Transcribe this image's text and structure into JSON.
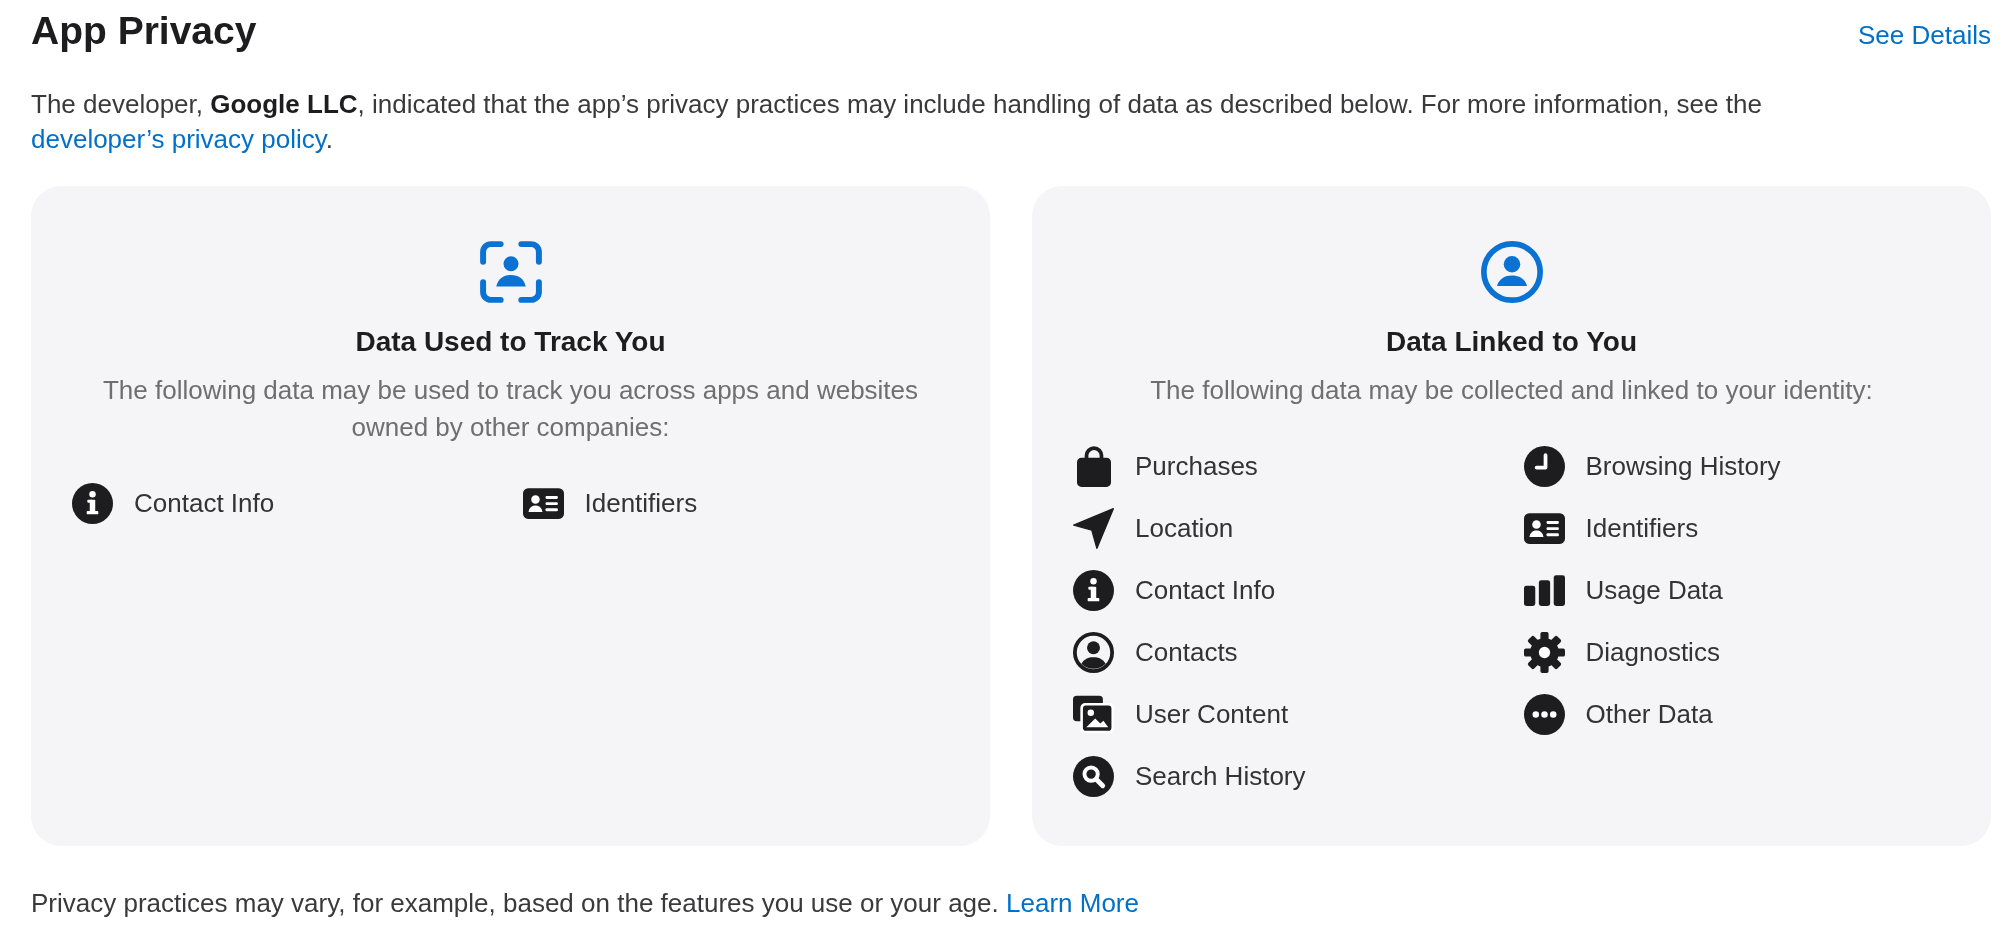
{
  "header": {
    "title": "App Privacy",
    "link": "See Details"
  },
  "intro": {
    "text": "The developer, **Google LLC**, indicated that the app’s privacy practices may include handling of data as described below. For more information, see the",
    "link": "developer’s privacy policy",
    "after": "."
  },
  "cards": [
    {
      "kind": "tracking",
      "title": "Data Used to Track You",
      "description": "The following data may be used to track you across apps and websites owned by other companies:",
      "items": [
        {
          "kind": "info",
          "label": "Contact Info"
        },
        {
          "kind": "idcard",
          "label": "Identifiers"
        }
      ]
    },
    {
      "kind": "linked",
      "title": "Data Linked to You",
      "description": "The following data may be collected and linked to your identity:",
      "items": [
        {
          "kind": "bag",
          "label": "Purchases"
        },
        {
          "kind": "location",
          "label": "Location"
        },
        {
          "kind": "info",
          "label": "Contact Info"
        },
        {
          "kind": "person",
          "label": "Contacts"
        },
        {
          "kind": "photos",
          "label": "User Content"
        },
        {
          "kind": "search",
          "label": "Search History"
        },
        {
          "kind": "clock",
          "label": "Browsing History"
        },
        {
          "kind": "idcard",
          "label": "Identifiers"
        },
        {
          "kind": "bars",
          "label": "Usage Data"
        },
        {
          "kind": "gear",
          "label": "Diagnostics"
        },
        {
          "kind": "ellipsis",
          "label": "Other Data"
        }
      ]
    }
  ],
  "footer": {
    "text": "Privacy practices may vary, for example, based on the features you use or your age.",
    "link": "Learn More"
  }
}
